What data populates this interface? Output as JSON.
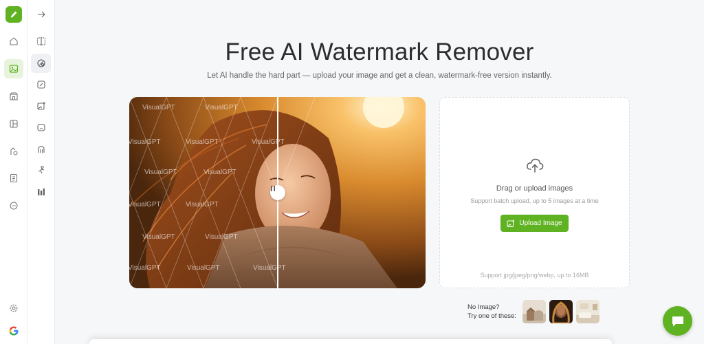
{
  "rail": {
    "items": [
      {
        "icon": "home-icon"
      },
      {
        "icon": "image-icon",
        "active": true
      },
      {
        "icon": "store-icon"
      },
      {
        "icon": "layout-icon"
      },
      {
        "icon": "shapes-icon"
      },
      {
        "icon": "document-icon"
      },
      {
        "icon": "chat-bubble-icon"
      }
    ],
    "bottom": [
      {
        "icon": "gear-icon"
      },
      {
        "icon": "google-icon"
      }
    ]
  },
  "tools": {
    "items": [
      {
        "icon": "arrow-right-icon"
      },
      {
        "icon": "split-compare-icon"
      },
      {
        "icon": "watermark-remover-icon",
        "active": true
      },
      {
        "icon": "edit-image-icon"
      },
      {
        "icon": "add-image-icon"
      },
      {
        "icon": "face-icon"
      },
      {
        "icon": "person-icon"
      },
      {
        "icon": "pose-icon"
      },
      {
        "icon": "bars-icon"
      }
    ]
  },
  "hero": {
    "title": "Free AI Watermark Remover",
    "subtitle": "Let AI handle the hard part — upload your image and get a clean, watermark-free version instantly."
  },
  "compare": {
    "watermark_text": "VisualGPT"
  },
  "upload": {
    "drag_text": "Drag or upload images",
    "batch_text": "Support batch upload, up to 5 images at a time",
    "button_label": "Upload Image",
    "format_text": "Support jpg/jpeg/png/webp, up to 16MB"
  },
  "samples": {
    "line1": "No Image?",
    "line2": "Try one of these:"
  },
  "colors": {
    "brand": "#5fb322",
    "active_bg": "#e7f3dc"
  }
}
